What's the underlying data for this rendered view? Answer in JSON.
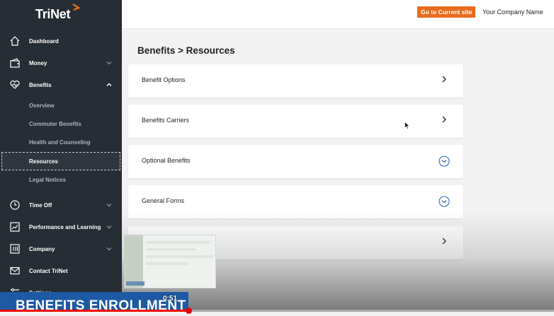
{
  "brand": {
    "name": "TriNet"
  },
  "header": {
    "goto_label": "Go to Current site",
    "company": "Your Company Name"
  },
  "sidebar": {
    "items": [
      {
        "label": "Dashboard",
        "icon": "home-icon"
      },
      {
        "label": "Money",
        "icon": "wallet-icon"
      },
      {
        "label": "Benefits",
        "icon": "heart-icon"
      },
      {
        "label": "Time Off",
        "icon": "clock-icon"
      },
      {
        "label": "Performance and Learning",
        "icon": "chart-icon"
      },
      {
        "label": "Company",
        "icon": "company-icon"
      },
      {
        "label": "Contact TriNet",
        "icon": "mail-icon"
      },
      {
        "label": "Settings",
        "icon": "sliders-icon"
      }
    ],
    "benefits_sub": [
      "Overview",
      "Commuter Benefits",
      "Health and Counseling",
      "Resources",
      "Legal Notices"
    ],
    "active_sub": "Resources"
  },
  "main": {
    "breadcrumb": "Benefits  > Resources",
    "cards": [
      {
        "label": "Benefit Options",
        "action": "chevron-right-icon"
      },
      {
        "label": "Benefits Carriers",
        "action": "chevron-right-icon"
      },
      {
        "label": "Optional Benefits",
        "action": "chevron-down-circle-icon"
      },
      {
        "label": "General Forms",
        "action": "chevron-down-circle-icon"
      },
      {
        "label": "",
        "action": "chevron-right-icon"
      }
    ]
  },
  "video": {
    "banner_text": "BENEFITS ENROLLMENT",
    "time": "0:51",
    "progress": 0.34
  },
  "colors": {
    "accent": "#e86c1d",
    "sidebar": "#272d34",
    "banner": "#1e5aa3",
    "progress": "#e00000"
  }
}
